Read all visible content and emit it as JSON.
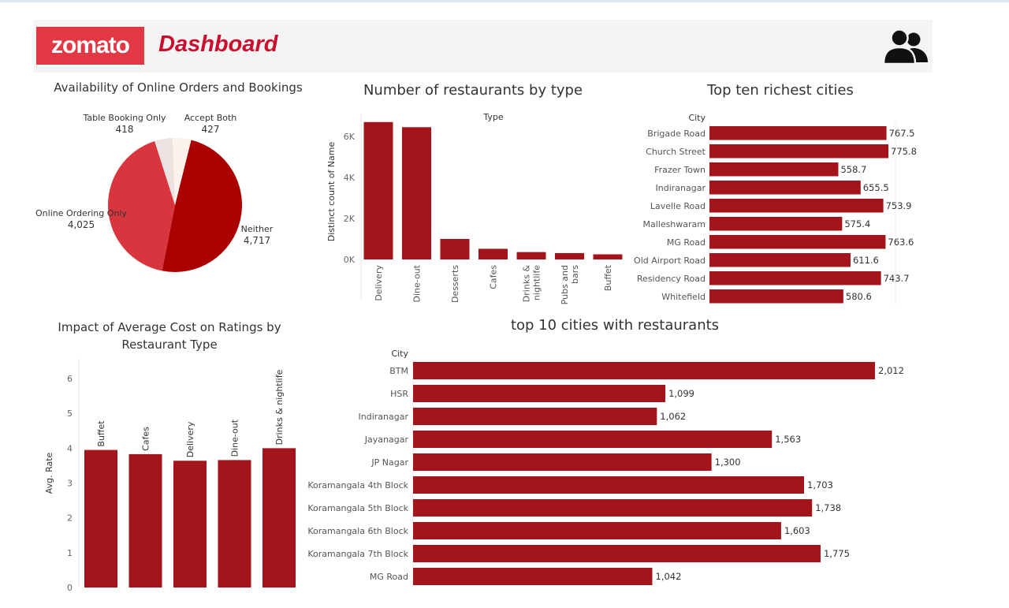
{
  "header": {
    "logo_text": "zomato",
    "title": "Dashboard",
    "user_icon": "users-icon"
  },
  "colors": {
    "bar": "#a3151b",
    "pie_online": "#d8353f",
    "pie_neither": "#ab0000",
    "pie_table": "#ece2df",
    "pie_both": "#fbf2ec"
  },
  "chart_data": [
    {
      "type": "pie",
      "title": "Availability of Online Orders and Bookings",
      "slices": [
        {
          "label": "Neither",
          "value": 4717,
          "value_text": "4,717"
        },
        {
          "label": "Online Ordering Only",
          "value": 4025,
          "value_text": "4,025"
        },
        {
          "label": "Table Booking Only",
          "value": 418,
          "value_text": "418"
        },
        {
          "label": "Accept Both",
          "value": 427,
          "value_text": "427"
        }
      ]
    },
    {
      "type": "bar",
      "title": "Number of restaurants by type",
      "xlabel": "Type",
      "ylabel": "Distinct count of Name",
      "categories": [
        "Delivery",
        "Dine-out",
        "Desserts",
        "Cafes",
        "Drinks & nightlife",
        "Pubs and bars",
        "Buffet"
      ],
      "values": [
        6700,
        6450,
        1000,
        520,
        360,
        310,
        250
      ],
      "yticks": [
        0,
        2000,
        4000,
        6000
      ],
      "yticklabels": [
        "0K",
        "2K",
        "4K",
        "6K"
      ],
      "ylim": [
        0,
        7000
      ]
    },
    {
      "type": "bar",
      "orientation": "horizontal",
      "title": "Top ten richest cities",
      "ylabel": "City",
      "categories": [
        "Brigade Road",
        "Church Street",
        "Frazer Town",
        "Indiranagar",
        "Lavelle Road",
        "Malleshwaram",
        "MG Road",
        "Old Airport Road",
        "Residency Road",
        "Whitefield"
      ],
      "values": [
        767.5,
        775.8,
        558.7,
        655.5,
        753.9,
        575.4,
        763.6,
        611.6,
        743.7,
        580.6
      ],
      "value_labels": [
        "767.5",
        "775.8",
        "558.7",
        "655.5",
        "753.9",
        "575.4",
        "763.6",
        "611.6",
        "743.7",
        "580.6"
      ]
    },
    {
      "type": "bar",
      "title": "Impact of Average Cost on Ratings by Restaurant Type",
      "ylabel": "Avg. Rate",
      "categories": [
        "Buffet",
        "Cafes",
        "Delivery",
        "Dine-out",
        "Drinks & nightlife"
      ],
      "values": [
        3.95,
        3.83,
        3.64,
        3.66,
        4.0
      ],
      "yticks": [
        0,
        1,
        2,
        3,
        4,
        5,
        6
      ],
      "ylim": [
        0,
        6.5
      ]
    },
    {
      "type": "bar",
      "orientation": "horizontal",
      "title": "top 10 cities with restaurants",
      "ylabel": "City",
      "categories": [
        "BTM",
        "HSR",
        "Indiranagar",
        "Jayanagar",
        "JP Nagar",
        "Koramangala 4th Block",
        "Koramangala 5th Block",
        "Koramangala 6th Block",
        "Koramangala 7th Block",
        "MG Road"
      ],
      "values": [
        2012,
        1099,
        1062,
        1563,
        1300,
        1703,
        1738,
        1603,
        1775,
        1042
      ],
      "value_labels": [
        "2,012",
        "1,099",
        "1,062",
        "1,563",
        "1,300",
        "1,703",
        "1,738",
        "1,603",
        "1,775",
        "1,042"
      ]
    }
  ]
}
